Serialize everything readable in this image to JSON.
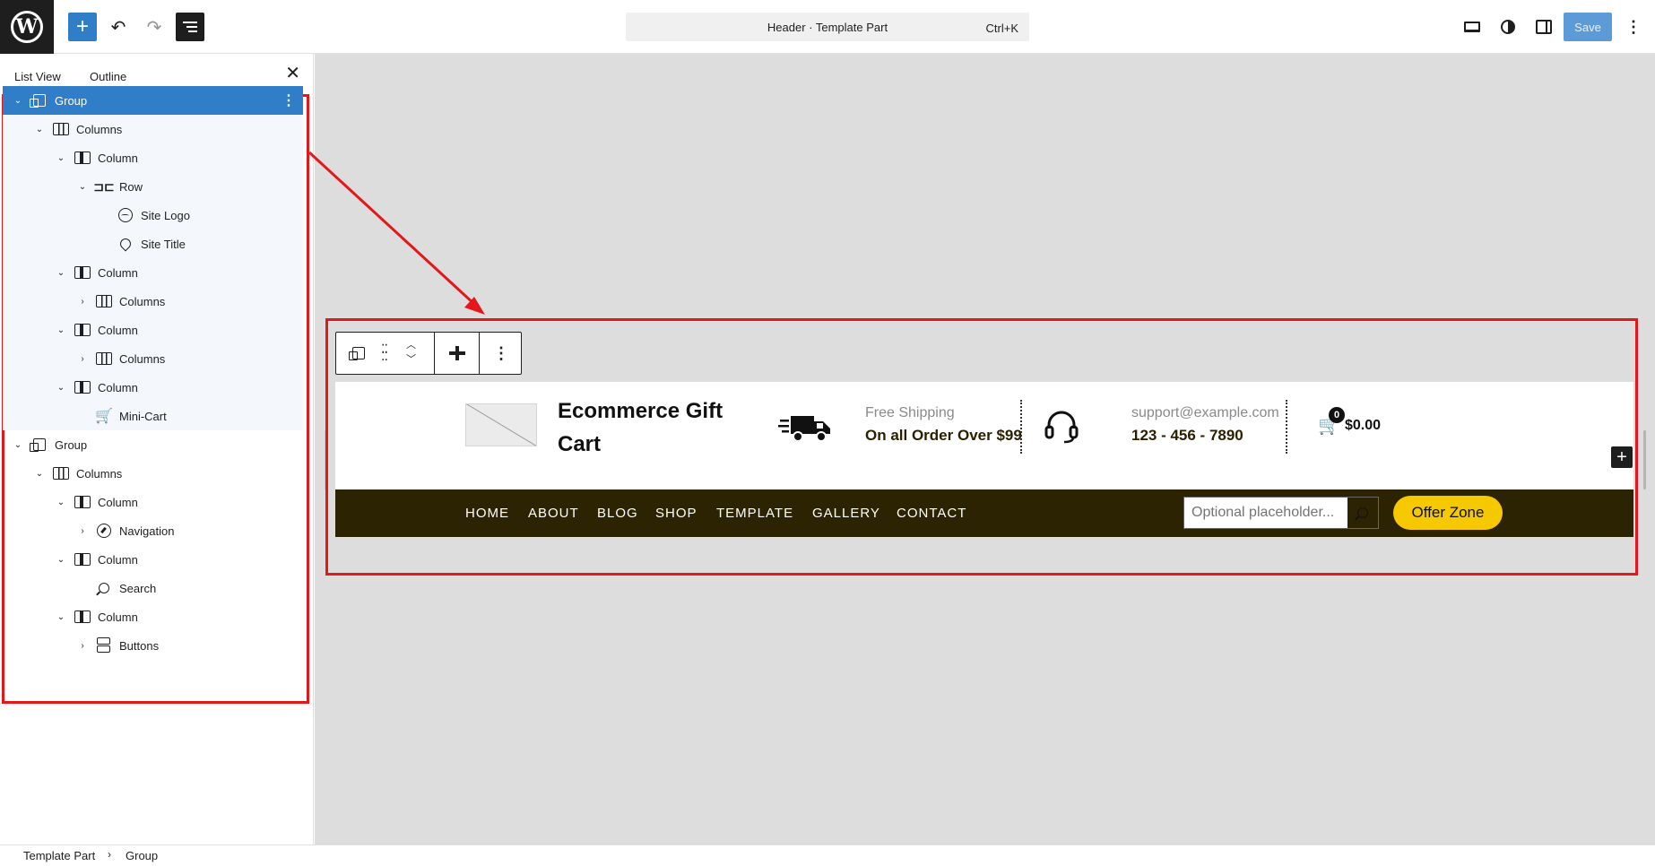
{
  "topbar": {
    "add_label": "+",
    "undo_label": "↶",
    "redo_label": "↷",
    "command_title": "Header · Template Part",
    "command_shortcut": "Ctrl+K",
    "save_label": "Save",
    "options_label": "⋮"
  },
  "sidebar": {
    "tab_list": "List View",
    "tab_outline": "Outline",
    "close_label": "✕",
    "tree": [
      {
        "label": "Group",
        "depth": 0,
        "chev": "⌄",
        "icon": "group-icon",
        "selected": true
      },
      {
        "label": "Columns",
        "depth": 1,
        "chev": "⌄",
        "icon": "columns-icon"
      },
      {
        "label": "Column",
        "depth": 2,
        "chev": "⌄",
        "icon": "column-icon"
      },
      {
        "label": "Row",
        "depth": 3,
        "chev": "⌄",
        "icon": "row-icon"
      },
      {
        "label": "Site Logo",
        "depth": 4,
        "chev": "",
        "icon": "site-logo-icon"
      },
      {
        "label": "Site Title",
        "depth": 4,
        "chev": "",
        "icon": "pin-icon"
      },
      {
        "label": "Column",
        "depth": 2,
        "chev": "⌄",
        "icon": "column-icon"
      },
      {
        "label": "Columns",
        "depth": 3,
        "chev": "›",
        "icon": "columns-icon"
      },
      {
        "label": "Column",
        "depth": 2,
        "chev": "⌄",
        "icon": "column-icon"
      },
      {
        "label": "Columns",
        "depth": 3,
        "chev": "›",
        "icon": "columns-icon"
      },
      {
        "label": "Column",
        "depth": 2,
        "chev": "⌄",
        "icon": "column-icon"
      },
      {
        "label": "Mini-Cart",
        "depth": 3,
        "chev": "",
        "icon": "cart-icon"
      },
      {
        "label": "Group",
        "depth": 0,
        "chev": "⌄",
        "icon": "group-icon"
      },
      {
        "label": "Columns",
        "depth": 1,
        "chev": "⌄",
        "icon": "columns-icon"
      },
      {
        "label": "Column",
        "depth": 2,
        "chev": "⌄",
        "icon": "column-icon"
      },
      {
        "label": "Navigation",
        "depth": 3,
        "chev": "›",
        "icon": "navigation-icon"
      },
      {
        "label": "Column",
        "depth": 2,
        "chev": "⌄",
        "icon": "column-icon"
      },
      {
        "label": "Search",
        "depth": 3,
        "chev": "",
        "icon": "search-icon"
      },
      {
        "label": "Column",
        "depth": 2,
        "chev": "⌄",
        "icon": "column-icon"
      },
      {
        "label": "Buttons",
        "depth": 3,
        "chev": "›",
        "icon": "buttons-icon"
      }
    ]
  },
  "preview": {
    "site_title": "Ecommerce Gift Cart",
    "shipping_label": "Free Shipping",
    "shipping_value": "On all Order Over $99",
    "support_email": "support@example.com",
    "support_phone": "123 - 456 - 7890",
    "cart_count": "0",
    "cart_total": "$0.00",
    "nav": [
      "HOME",
      "ABOUT",
      "BLOG",
      "SHOP",
      "TEMPLATE",
      "GALLERY",
      "CONTACT"
    ],
    "search_placeholder": "Optional placeholder...",
    "offer_label": "Offer Zone",
    "add_block_label": "+"
  },
  "footer": {
    "crumb_1": "Template Part",
    "crumb_sep": "›",
    "crumb_2": "Group"
  },
  "colors": {
    "accent": "#2f7ec7",
    "highlight": "#e4171b",
    "nav_bg": "#2c2302",
    "offer_bg": "#f5c800"
  }
}
